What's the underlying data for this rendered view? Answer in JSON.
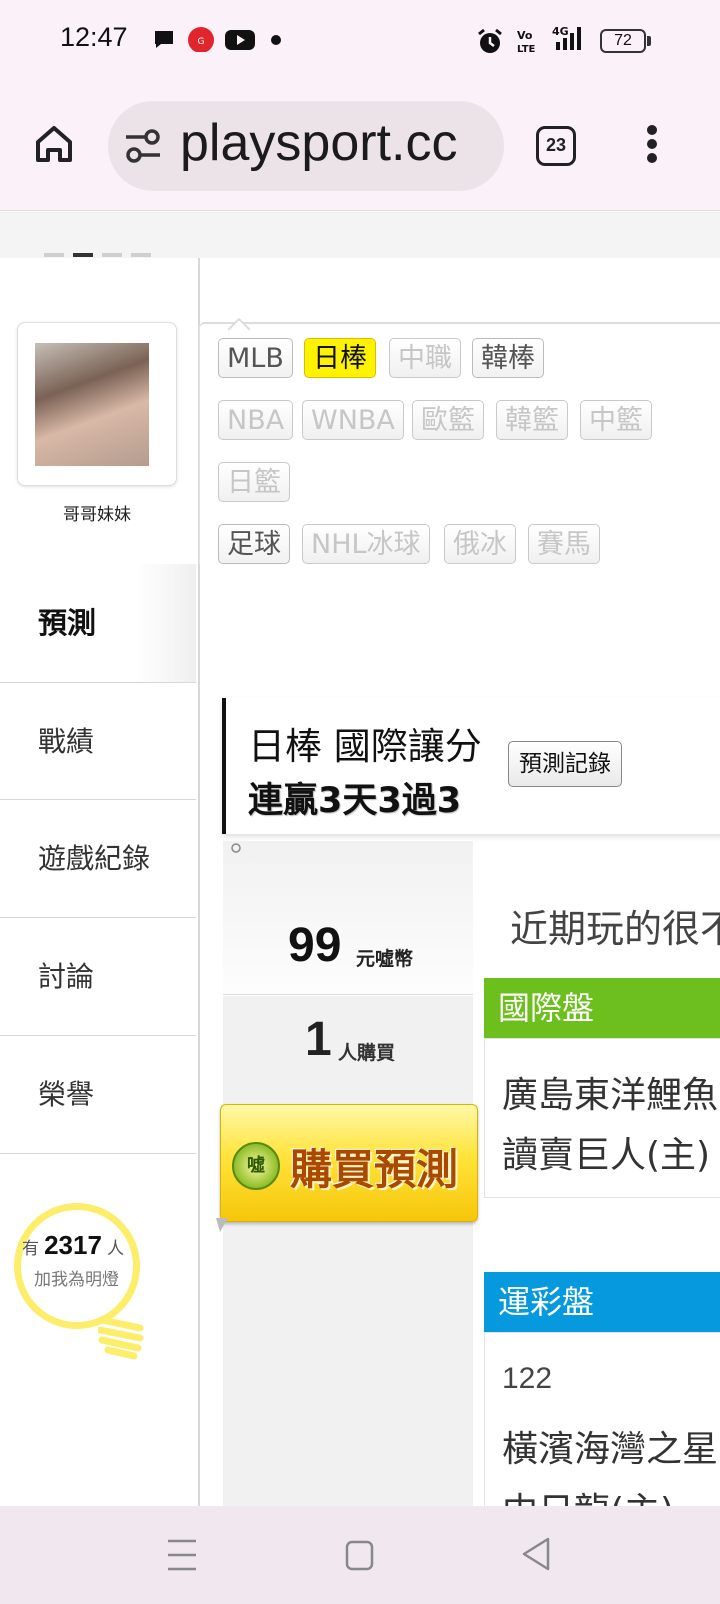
{
  "status_bar": {
    "time": "12:47",
    "battery": "72",
    "icons": [
      "chat-bubble-icon",
      "app-badge-icon",
      "youtube-icon",
      "dot-icon",
      "alarm-icon",
      "volte-icon",
      "signal-4g-icon",
      "battery-icon"
    ]
  },
  "browser": {
    "url": "playsport.cc",
    "tab_count": "23"
  },
  "profile": {
    "username": "哥哥妹妹"
  },
  "menu": {
    "active": "預測",
    "items": [
      "戰績",
      "遊戲紀錄",
      "討論",
      "榮譽"
    ]
  },
  "fans": {
    "prefix": "有",
    "count": "2317",
    "suffix": "人",
    "caption": "加我為明燈"
  },
  "tags": {
    "row1": [
      "MLB",
      "日棒",
      "中職",
      "韓棒"
    ],
    "row2": [
      "NBA",
      "WNBA",
      "歐籃",
      "韓籃",
      "中籃"
    ],
    "row3": [
      "日籃"
    ],
    "row4": [
      "足球",
      "NHL冰球",
      "俄冰",
      "賽馬"
    ],
    "selected": "日棒"
  },
  "prediction": {
    "title": "日棒 國際讓分",
    "streak": "連贏3天3過3",
    "record_button": "預測記錄",
    "price": "99",
    "price_unit": "元噓幣",
    "buyers": "1",
    "buyers_unit": "人購買",
    "buy_button": "購買預測",
    "buy_coin": "噓"
  },
  "content": {
    "comment": "近期玩的很不",
    "intl_header": "國際盤",
    "intl_team1": "廣島東洋鯉魚",
    "intl_team2": "讀賣巨人(主)",
    "lottery_header": "運彩盤",
    "lottery_number": "122",
    "lottery_team1": "橫濱海灣之星",
    "lottery_team2": "中日龍(主)"
  },
  "colors": {
    "intl_header": "#6cbf1c",
    "lottery_header": "#0799dd",
    "selected_tag": "#fff200",
    "bulb": "#fcee6a"
  }
}
